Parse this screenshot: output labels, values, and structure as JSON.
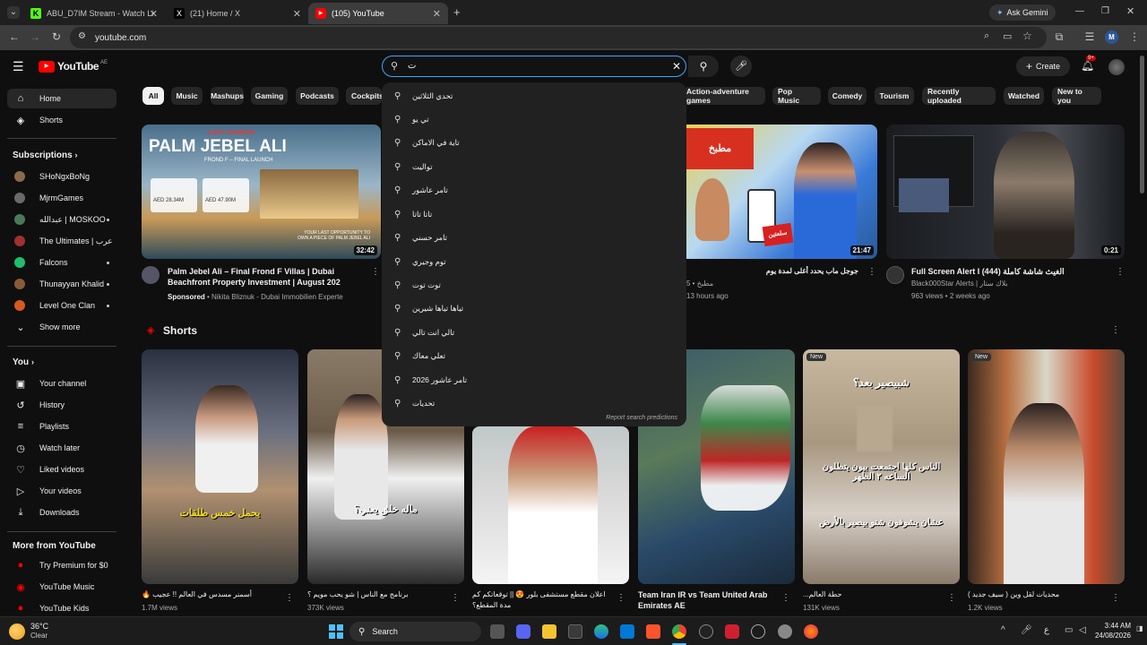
{
  "browser": {
    "tabs": [
      {
        "label": "ABU_D7IM Stream - Watch Liv",
        "color": "#53fc18",
        "letter": "K"
      },
      {
        "label": "(21) Home / X",
        "color": "#000000",
        "letter": "X"
      },
      {
        "label": "(105) YouTube",
        "color": "#ff0000",
        "letter": "▶"
      }
    ],
    "new_tab": "+",
    "gemini": "Ask Gemini",
    "url": "youtube.com",
    "profile": "M"
  },
  "youtube": {
    "logo": "YouTube",
    "region": "AE",
    "search_value": "ت",
    "create_label": "Create",
    "notif_badge": "9+"
  },
  "sidebar": {
    "main": [
      {
        "label": "Home",
        "icon": "home-icon",
        "glyph": "⌂"
      },
      {
        "label": "Shorts",
        "icon": "shorts-icon",
        "glyph": "◈"
      }
    ],
    "subscriptions_title": "Subscriptions",
    "subscriptions": [
      {
        "label": "SHoNgxBoNg",
        "color": "#8a6a4a"
      },
      {
        "label": "MjrmGames",
        "color": "#6a6a6a"
      },
      {
        "label": "عبدالله | MOSKOO",
        "color": "#4a7a5a"
      },
      {
        "label": "The Ultimates | عرب",
        "color": "#a03030"
      },
      {
        "label": "Falcons",
        "color": "#1fbf6a"
      },
      {
        "label": "Thunayyan Khalid",
        "color": "#8a5a3a"
      },
      {
        "label": "Level One Clan",
        "color": "#d85a20"
      }
    ],
    "show_more": "Show more",
    "you_title": "You",
    "you_items": [
      {
        "label": "Your channel",
        "glyph": "▣"
      },
      {
        "label": "History",
        "glyph": "↺"
      },
      {
        "label": "Playlists",
        "glyph": "≡"
      },
      {
        "label": "Watch later",
        "glyph": "◷"
      },
      {
        "label": "Liked videos",
        "glyph": "♡"
      },
      {
        "label": "Your videos",
        "glyph": "▷"
      },
      {
        "label": "Downloads",
        "glyph": "⤓"
      }
    ],
    "more_title": "More from YouTube",
    "more_items": [
      {
        "label": "Try Premium for $0"
      },
      {
        "label": "YouTube Music"
      },
      {
        "label": "YouTube Kids"
      }
    ]
  },
  "chips": [
    "All",
    "Music",
    "Mashups",
    "Gaming",
    "Podcasts",
    "Cockpits",
    "Action-adventure games",
    "Pop Music",
    "Comedy",
    "Tourism",
    "Recently uploaded",
    "Watched",
    "New to you"
  ],
  "suggestions": [
    "تحدي الثلاثين",
    "تي يو",
    "تاية في الاماكن",
    "تواليت",
    "تامر عاشور",
    "تاتا تاتا",
    "تامر حسني",
    "توم وجيري",
    "توت توت",
    "تياها تياها شيرين",
    "تالي انت تالي",
    "تعلي معاك",
    "تامر عاشور 2026",
    "تحديات"
  ],
  "report_text": "Report search predictions",
  "videos": [
    {
      "title": "Palm Jebel Ali – Final Frond F Villas | Dubai Beachfront Property Investment | August 202",
      "sponsored": "Sponsored",
      "channel": "Nikita Bliznuk - Dubai Immobilien Experte",
      "duration": "32:42"
    },
    {
      "title": "جوجل ماب يحدد أغلى لمدة يوم",
      "channel": "مطبخ",
      "meta": "13 hours ago",
      "views_prefix": "5",
      "duration": "21:47"
    },
    {
      "title": "Full Screen Alert I (444) الغيث شاشة كاملة",
      "channel": "Black000Star Alerts | بلاك ستار",
      "meta": "963 views • 2 weeks ago",
      "duration": "0:21"
    }
  ],
  "thumb_text": {
    "last_chance": "LAST CHANCE!",
    "palm": "PALM JEBEL ALI",
    "frond": "FROND F – FINAL LAUNCH",
    "price1": "AED 28.34M",
    "price2": "AED 47.90M",
    "your_last": "YOUR LAST OPPORTUNITY TO OWN A PIECE OF PALM JEBEL ALI",
    "ar_food": "مطبخ",
    "ar_map": "سلعتين"
  },
  "shorts_title": "Shorts",
  "shorts": [
    {
      "caption": "يحمل خمس طلقات",
      "title": "أسمنر مسدس في العالم !! عجيب 🔥",
      "views": "1.7M views",
      "badge": ""
    },
    {
      "caption": "ماله خلق يعني؟",
      "title": "برنامج مع الناس | شو يحب مويم ؟",
      "views": "373K views",
      "badge": ""
    },
    {
      "caption": "",
      "title": "اعلان مقطع مستشفى بلور 😍 || توقعاتكم كم مدة المقطع؟",
      "views": "",
      "badge": ""
    },
    {
      "caption": "",
      "title": "Team Iran IR vs Team United Arab Emirates AE",
      "views": "",
      "badge": ""
    },
    {
      "caption": "الناس كلها اجتمعت بيون يتطلون الساعه ٢ الظهر",
      "caption2": "عشان يشوفون شنو بيصير بالأرض",
      "top": "شبيصير بعد؟",
      "title": "...حطة العالم",
      "views": "131K views",
      "badge": "New"
    },
    {
      "caption": "",
      "title": "محديات لقل وين ( سيف جديد )",
      "views": "1.2K views",
      "badge": "New"
    }
  ],
  "taskbar": {
    "weather_temp": "36°C",
    "weather_desc": "Clear",
    "search": "Search",
    "time": "3:44 AM",
    "date": "24/08/2026",
    "lang": "ع"
  }
}
